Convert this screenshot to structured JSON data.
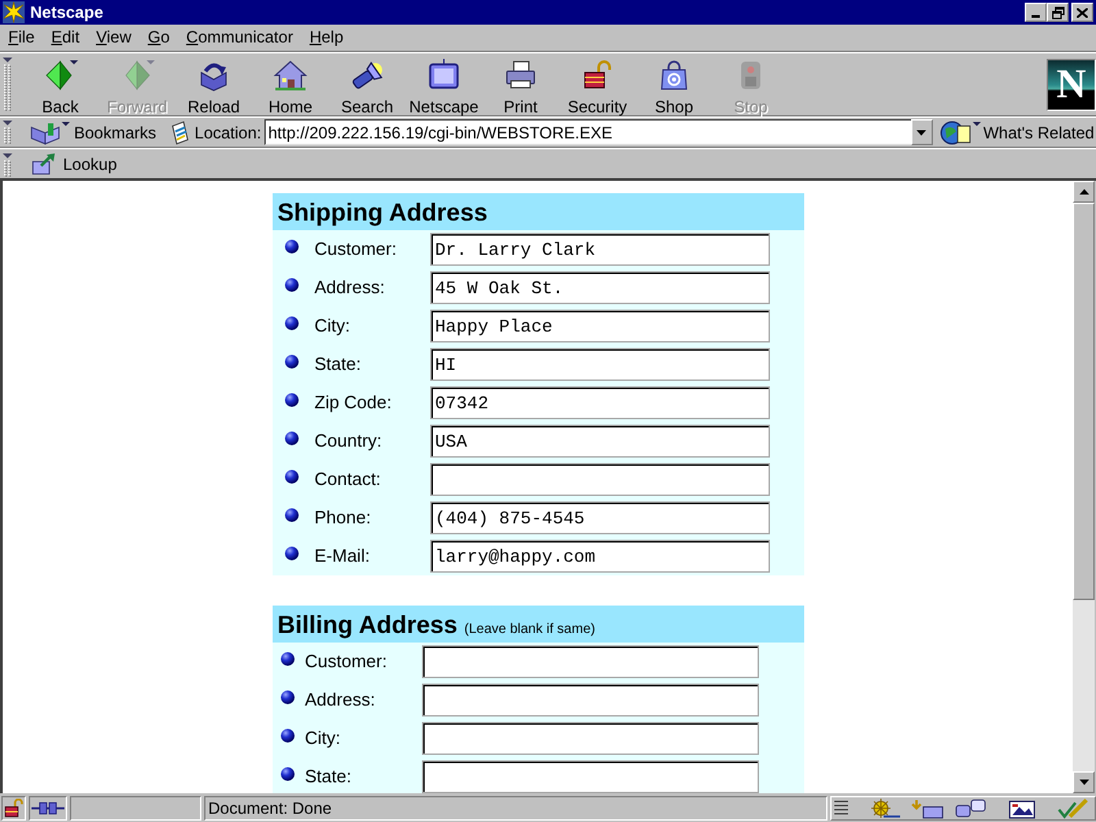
{
  "window": {
    "title": "Netscape",
    "logo_letter": "N"
  },
  "menu": [
    {
      "label": "File"
    },
    {
      "label": "Edit"
    },
    {
      "label": "View"
    },
    {
      "label": "Go"
    },
    {
      "label": "Communicator"
    },
    {
      "label": "Help"
    }
  ],
  "toolbar": [
    {
      "label": "Back",
      "disabled": false
    },
    {
      "label": "Forward",
      "disabled": true
    },
    {
      "label": "Reload",
      "disabled": false
    },
    {
      "label": "Home",
      "disabled": false
    },
    {
      "label": "Search",
      "disabled": false
    },
    {
      "label": "Netscape",
      "disabled": false
    },
    {
      "label": "Print",
      "disabled": false
    },
    {
      "label": "Security",
      "disabled": false
    },
    {
      "label": "Shop",
      "disabled": false
    },
    {
      "label": "Stop",
      "disabled": true
    }
  ],
  "location_bar": {
    "bookmarks": "Bookmarks",
    "location_label": "Location:",
    "url": "http://209.222.156.19/cgi-bin/WEBSTORE.EXE",
    "whats_related": "What's Related"
  },
  "personal_toolbar": [
    {
      "label": "Lookup"
    }
  ],
  "sections": [
    {
      "title": "Shipping Address",
      "fields": [
        {
          "label": "Customer:",
          "value": "Dr. Larry Clark"
        },
        {
          "label": "Address:",
          "value": "45 W Oak St."
        },
        {
          "label": "City:",
          "value": "Happy Place"
        },
        {
          "label": "State:",
          "value": "HI"
        },
        {
          "label": "Zip Code:",
          "value": "07342"
        },
        {
          "label": "Country:",
          "value": "USA"
        },
        {
          "label": "Contact:"
        },
        {
          "label": "Phone:",
          "value": "(404) 875-4545"
        },
        {
          "label": "E-Mail:",
          "value": "larry@happy.com"
        }
      ]
    },
    {
      "title": "Billing Address",
      "note": "(Leave blank if same)",
      "fields": [
        {
          "label": "Customer:"
        },
        {
          "label": "Address:"
        },
        {
          "label": "City:"
        },
        {
          "label": "State:"
        }
      ]
    }
  ],
  "status_bar": {
    "text": "Document: Done"
  }
}
